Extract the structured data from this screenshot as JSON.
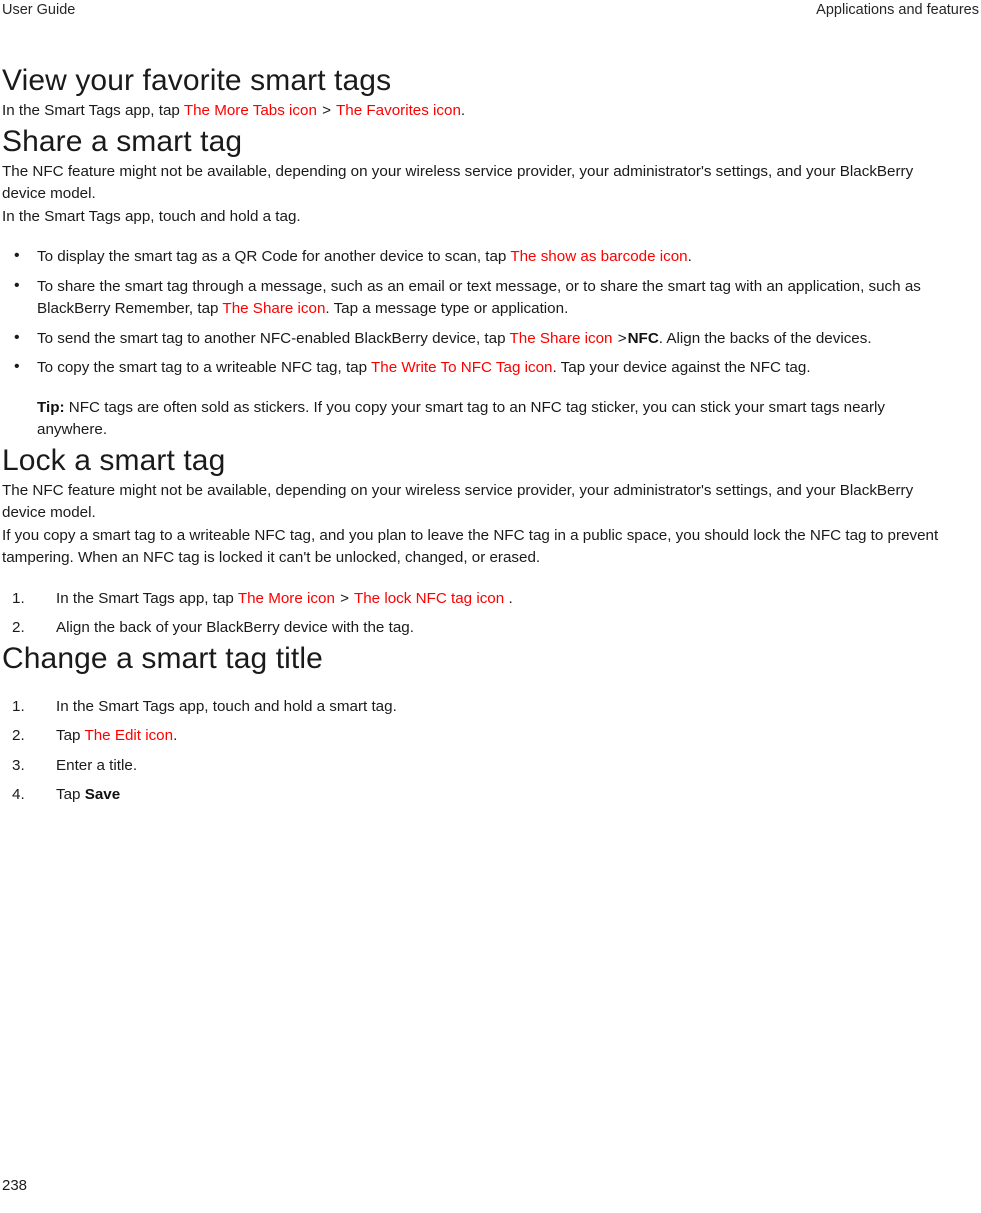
{
  "header": {
    "left": "User Guide",
    "right": "Applications and features"
  },
  "footer": {
    "page_number": "238"
  },
  "colors": {
    "icon_reference": "#fe0000",
    "text": "#1a1a1a",
    "background": "#ffffff"
  },
  "sections": {
    "view_favorites": {
      "heading": "View your favorite smart tags",
      "paragraph": {
        "lead": "In the Smart Tags app, tap ",
        "icon1": "The More Tabs icon",
        "separator": ">",
        "icon2": "The Favorites icon",
        "tail": "."
      }
    },
    "share": {
      "heading": "Share a smart tag",
      "intro": "The NFC feature might not be available, depending on your wireless service provider, your administrator's settings, and your BlackBerry device model.",
      "lead_in": "In the Smart Tags app, touch and hold a tag.",
      "bullets": [
        {
          "lead": "To display the smart tag as a QR Code for another device to scan, tap ",
          "icon1": "The show as barcode icon",
          "tail": "."
        },
        {
          "lead": "To share the smart tag through a message, such as an email or text message, or to share the smart tag with an application, such as BlackBerry Remember, tap ",
          "icon1": "The Share icon",
          "tail": ". Tap a message type or application."
        },
        {
          "lead": "To send the smart tag to another NFC-enabled BlackBerry device, tap ",
          "icon1": "The Share icon",
          "separator": ">",
          "bold": "NFC",
          "tail": ". Align the backs of the devices."
        },
        {
          "lead": "To copy the smart tag to a writeable NFC tag, tap ",
          "icon1": "The Write To NFC Tag icon",
          "tail": ". Tap your device against the NFC tag."
        }
      ],
      "tip": {
        "label": "Tip:",
        "text": " NFC tags are often sold as stickers. If you copy your smart tag to an NFC tag sticker, you can stick your smart tags nearly anywhere."
      }
    },
    "lock": {
      "heading": "Lock a smart tag",
      "intro": "The NFC feature might not be available, depending on your wireless service provider, your administrator's settings, and your BlackBerry device model.",
      "explanation": "If you copy a smart tag to a writeable NFC tag, and you plan to leave the NFC tag in a public space, you should lock the NFC tag to prevent tampering. When an NFC tag is locked it can't be unlocked, changed, or erased.",
      "steps": [
        {
          "lead": "In the Smart Tags app, tap ",
          "icon1": "The More icon",
          "separator": ">",
          "icon2": "The lock NFC tag icon",
          "tail": "."
        },
        {
          "lead": "Align the back of your BlackBerry device with the tag.",
          "tail": ""
        }
      ]
    },
    "change_title": {
      "heading": "Change a smart tag title",
      "steps": [
        {
          "lead": "In the Smart Tags app, touch and hold a smart tag."
        },
        {
          "lead": "Tap ",
          "icon1": "The Edit icon",
          "tail": "."
        },
        {
          "lead": "Enter a title."
        },
        {
          "lead": "Tap ",
          "bold": "Save"
        }
      ]
    }
  }
}
